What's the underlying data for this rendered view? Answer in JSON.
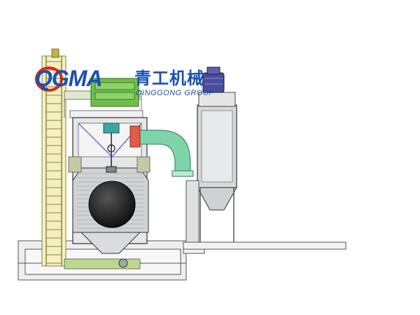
{
  "logo": {
    "latin": "QGMA",
    "chinese": "青工机械",
    "english": "QINGGONG GROUP"
  },
  "colors": {
    "brand_red": "#e2231a",
    "brand_blue": "#1b4fb3",
    "ladder_yellow": "#e6e07a",
    "chamber_gray": "#cfd3d6",
    "drum_black": "#1d1d1d",
    "hopper_green": "#6fbe4a",
    "duct_green": "#7fd3a8",
    "motor_purple": "#4a4c9e",
    "stand_frame_blue": "#6a6fd4",
    "outline": "#333333"
  },
  "components": {
    "ladder": "ladder-icon",
    "blast_chamber": "blast-chamber-icon",
    "hanging_drum": "sphere-workpiece-icon",
    "separator": "separator-hopper-icon",
    "duct": "elbow-duct-icon",
    "dust_collector": "dust-collector-icon",
    "fan_motor": "fan-motor-icon"
  }
}
